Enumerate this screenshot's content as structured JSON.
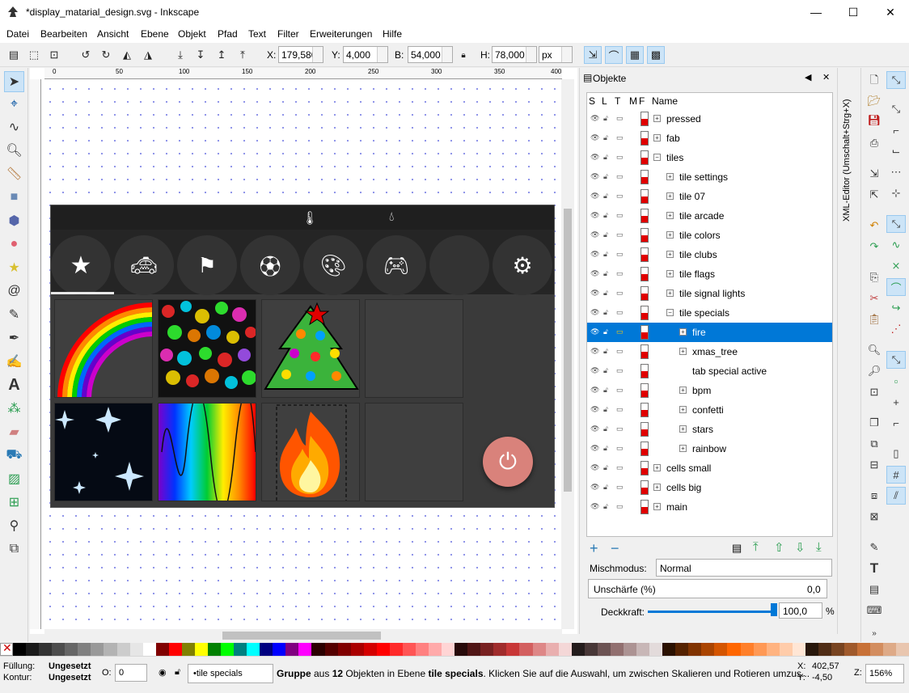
{
  "app": {
    "title": "*display_matarial_design.svg - Inkscape"
  },
  "menu": [
    "Datei",
    "Bearbeiten",
    "Ansicht",
    "Ebene",
    "Objekt",
    "Pfad",
    "Text",
    "Filter",
    "Erweiterungen",
    "Hilfe"
  ],
  "toolbar": {
    "x_label": "X:",
    "x_value": "179,580",
    "y_label": "Y:",
    "y_value": "4,000",
    "w_label": "B:",
    "w_value": "54,000",
    "h_label": "H:",
    "h_value": "78,000",
    "unit": "px"
  },
  "ruler_marks": [
    "0",
    "50",
    "100",
    "150",
    "200",
    "250",
    "300",
    "350",
    "400"
  ],
  "objects_panel": {
    "title": "Objekte",
    "columns": [
      "S",
      "L",
      "T",
      "M",
      "F",
      "Name"
    ],
    "rows": [
      {
        "name": "pressed",
        "indent": 0,
        "expander": "+",
        "selected": false
      },
      {
        "name": "fab",
        "indent": 0,
        "expander": "+",
        "selected": false
      },
      {
        "name": "tiles",
        "indent": 0,
        "expander": "−",
        "selected": false
      },
      {
        "name": "tile settings",
        "indent": 1,
        "expander": "+",
        "selected": false
      },
      {
        "name": "tile 07",
        "indent": 1,
        "expander": "+",
        "selected": false
      },
      {
        "name": "tile arcade",
        "indent": 1,
        "expander": "+",
        "selected": false
      },
      {
        "name": "tile colors",
        "indent": 1,
        "expander": "+",
        "selected": false
      },
      {
        "name": "tile clubs",
        "indent": 1,
        "expander": "+",
        "selected": false
      },
      {
        "name": "tile flags",
        "indent": 1,
        "expander": "+",
        "selected": false
      },
      {
        "name": "tile signal lights",
        "indent": 1,
        "expander": "+",
        "selected": false
      },
      {
        "name": "tile specials",
        "indent": 1,
        "expander": "−",
        "selected": false
      },
      {
        "name": "fire",
        "indent": 2,
        "expander": "+",
        "selected": true
      },
      {
        "name": "xmas_tree",
        "indent": 2,
        "expander": "+",
        "selected": false
      },
      {
        "name": "tab special active",
        "indent": 2,
        "expander": "",
        "selected": false
      },
      {
        "name": "bpm",
        "indent": 2,
        "expander": "+",
        "selected": false
      },
      {
        "name": "confetti",
        "indent": 2,
        "expander": "+",
        "selected": false
      },
      {
        "name": "stars",
        "indent": 2,
        "expander": "+",
        "selected": false
      },
      {
        "name": "rainbow",
        "indent": 2,
        "expander": "+",
        "selected": false
      },
      {
        "name": "cells small",
        "indent": 0,
        "expander": "+",
        "selected": false
      },
      {
        "name": "cells big",
        "indent": 0,
        "expander": "+",
        "selected": false
      },
      {
        "name": "main",
        "indent": 0,
        "expander": "+",
        "selected": false
      }
    ],
    "blend_label": "Mischmodus:",
    "blend_value": "Normal",
    "blur_label": "Unschärfe (%)",
    "blur_value": "0,0",
    "opacity_label": "Deckkraft:",
    "opacity_value": "100,0",
    "opacity_unit": "%",
    "opacity_level": 1.0
  },
  "xml_editor_tab": "XML-Editor (Umschalt+Strg+X)",
  "status": {
    "fill_label": "Füllung:",
    "fill_value": "Ungesetzt",
    "stroke_label": "Kontur:",
    "stroke_value": "Ungesetzt",
    "opacity_label": "O:",
    "opacity_value": "0",
    "layer": "•tile specials",
    "message_pre": "Gruppe",
    "message_mid1": " aus ",
    "message_count": "12",
    "message_mid2": " Objekten in Ebene ",
    "message_layer": "tile specials",
    "message_post": ". Klicken Sie auf die Auswahl, um zwischen Skalieren und Rotieren umzus...",
    "x_label": "X:",
    "x_value": "402,57",
    "y_label": "Y:",
    "y_value": "-4,50",
    "zoom_label": "Z:",
    "zoom_value": "156%"
  },
  "colors": {
    "accent": "#0078d7",
    "fab": "#d9827b",
    "palette": [
      "#000000",
      "#1a1a1a",
      "#333333",
      "#4d4d4d",
      "#666666",
      "#808080",
      "#999999",
      "#b3b3b3",
      "#cccccc",
      "#e6e6e6",
      "#ffffff",
      "#800000",
      "#ff0000",
      "#808000",
      "#ffff00",
      "#008000",
      "#00ff00",
      "#008080",
      "#00ffff",
      "#000080",
      "#0000ff",
      "#800080",
      "#ff00ff",
      "#2b0000",
      "#550000",
      "#800000",
      "#aa0000",
      "#d40000",
      "#ff0000",
      "#ff2a2a",
      "#ff5555",
      "#ff8080",
      "#ffaaaa",
      "#ffd5d5",
      "#280b0b",
      "#501616",
      "#782121",
      "#a02c2c",
      "#c83737",
      "#d35f5f",
      "#de8787",
      "#e9afaf",
      "#f4d7d7",
      "#241c1c",
      "#483737",
      "#6c5353",
      "#916f6f",
      "#ac9393",
      "#c8b7b7",
      "#e3dbdb",
      "#2b1100",
      "#552200",
      "#803300",
      "#aa4400",
      "#d45500",
      "#ff6600",
      "#ff7f2a",
      "#ff9955",
      "#ffb380",
      "#ffccaa",
      "#ffe6d5",
      "#28170b",
      "#502d16",
      "#784421",
      "#a05a2c",
      "#c87137",
      "#d38d5f",
      "#deaa87",
      "#e9c6af"
    ]
  }
}
